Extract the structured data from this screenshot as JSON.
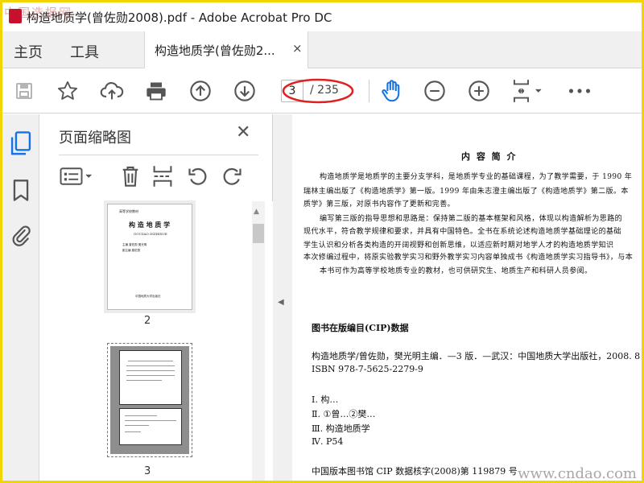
{
  "window": {
    "title": "构造地质学(曾佐勋2008).pdf - Adobe Acrobat Pro DC",
    "watermark_top": "中国造报网"
  },
  "menu": {
    "home_label": "主页",
    "tools_label": "工具",
    "doc_tab_label": "构造地质学(曾佐勋2...",
    "doc_tab_close": "×"
  },
  "toolbar": {
    "current_page": "3",
    "page_total": "/ 235",
    "icons": [
      "save-icon",
      "star-icon",
      "cloud-upload-icon",
      "print-icon",
      "page-up-icon",
      "page-down-icon",
      "hand-tool-icon",
      "zoom-out-icon",
      "zoom-in-icon",
      "fit-page-icon",
      "more-icon"
    ]
  },
  "sidebar": {
    "icons": [
      "page-thumbnails-icon",
      "bookmark-icon",
      "attachment-icon"
    ]
  },
  "thumbnails": {
    "title": "页面缩略图",
    "close": "✕",
    "tools": [
      "options-icon",
      "delete-icon",
      "insert-icon",
      "rotate-ccw-icon",
      "rotate-cw-icon"
    ],
    "pages": [
      {
        "label": "2",
        "header": "高等学校教材",
        "title": "构 造 地 质 学",
        "subtitle": "GOUZAO DIZHIXUE",
        "line1": "主编 曾佐勋 樊光明",
        "line2": "副主编 曾佐勋",
        "publisher": "中国地质大学出版社"
      },
      {
        "label": "3"
      }
    ]
  },
  "document": {
    "heading": "内 容 简 介",
    "para1": [
      "构造地质学是地质学的主要分支学科，是地质学专业的基础课程，为了教学需要，于 1990 年",
      "瑞林主编出版了《构造地质学》第一版。1999 年由朱志澄主编出版了《构造地质学》第二版。本",
      "质学》第三版，对原书内容作了更新和完善。"
    ],
    "para2": [
      "编写第三版的指导思想和思路是：保持第二版的基本框架和风格，体现以构造解析为思路的",
      "现代水平，符合教学规律和要求，并具有中国特色。全书在系统论述构造地质学基础理论的基础",
      "学生认识和分析各类构造的开阔视野和创新思维，以适应新时期对地学人才的构造地质学知识",
      "本次修编过程中，将原实验教学实习和野外教学实习内容单独成书《构造地质学实习指导书》，与本"
    ],
    "para3": "本书可作为高等学校地质专业的教材，也可供研究生、地质生产和科研人员参阅。",
    "cip_heading": "图书在版编目(CIP)数据",
    "cip_line1": "构造地质学/曾佐勋，樊光明主编．—3 版．—武汉：中国地质大学出版社，2008. 8",
    "cip_line2": "ISBN 978-7-5625-2279-9",
    "cip_items": [
      "Ⅰ. 构…",
      "Ⅱ. ①曾…②樊…",
      "Ⅲ. 构造地质学",
      "Ⅳ. P54"
    ],
    "cip_footer": "中国版本图书馆 CIP 数据核字(2008)第 119879 号",
    "watermark": "www.cndao.com"
  },
  "colors": {
    "frame": "#f2d500",
    "accent_blue": "#1473e6",
    "annotation_red": "#e02020"
  }
}
